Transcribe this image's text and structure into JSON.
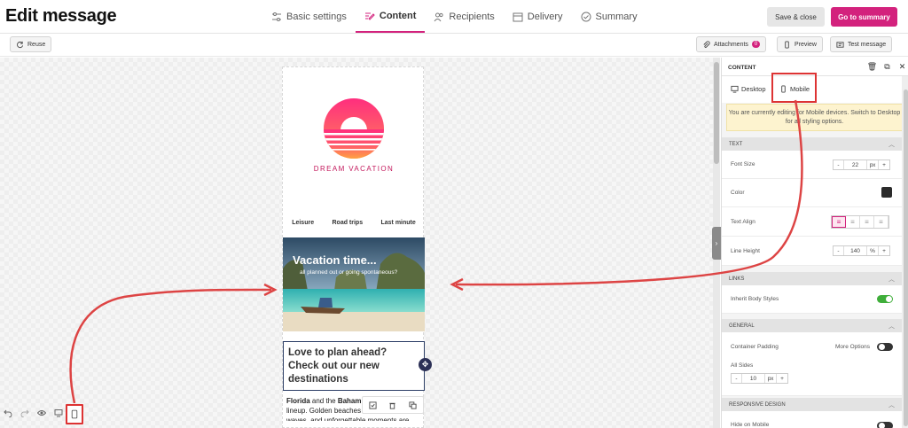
{
  "header": {
    "title": "Edit message",
    "steps": [
      {
        "label": "Basic settings",
        "icon": "sliders-icon"
      },
      {
        "label": "Content",
        "icon": "edit-icon",
        "active": true
      },
      {
        "label": "Recipients",
        "icon": "users-icon"
      },
      {
        "label": "Delivery",
        "icon": "calendar-icon"
      },
      {
        "label": "Summary",
        "icon": "check-circle-icon"
      }
    ],
    "save_close": "Save & close",
    "go_summary": "Go to summary",
    "accent_color": "#d3227d"
  },
  "toolbar": {
    "reuse": "Reuse",
    "attachments": "Attachments",
    "attachments_count": "0",
    "preview": "Preview",
    "test_message": "Test message"
  },
  "email": {
    "brand": "DREAM VACATION",
    "nav": [
      "Leisure",
      "Road trips",
      "Last minute"
    ],
    "hero_title": "Vacation time...",
    "hero_subtitle": "all planned out or going spontaneous?",
    "headline": "Love to plan ahead? Check out our new destinations",
    "body_bold_1": "Florida",
    "body_text_1": " and the ",
    "body_bold_2": "Baham",
    "body_line_2": "lineup. Golden beaches",
    "body_line_3": "waves, and unforgettable moments are"
  },
  "panel": {
    "title": "CONTENT",
    "tabs": {
      "desktop": "Desktop",
      "mobile": "Mobile"
    },
    "notice": "You are currently editing for Mobile devices. Switch to Desktop for all styling options.",
    "sections": {
      "text": "TEXT",
      "links": "LINKS",
      "general": "GENERAL",
      "responsive": "RESPONSIVE DESIGN"
    },
    "font_size_label": "Font Size",
    "font_size_value": "22",
    "font_size_unit": "px",
    "color_label": "Color",
    "text_align_label": "Text Align",
    "line_height_label": "Line Height",
    "line_height_value": "140",
    "line_height_unit": "%",
    "inherit_label": "Inherit Body Styles",
    "container_padding_label": "Container Padding",
    "more_options": "More Options",
    "all_sides": "All Sides",
    "padding_value": "10",
    "padding_unit": "px",
    "hide_mobile": "Hide on Mobile",
    "minus": "-",
    "plus": "+",
    "toggle_on_color": "#3fae3a"
  }
}
